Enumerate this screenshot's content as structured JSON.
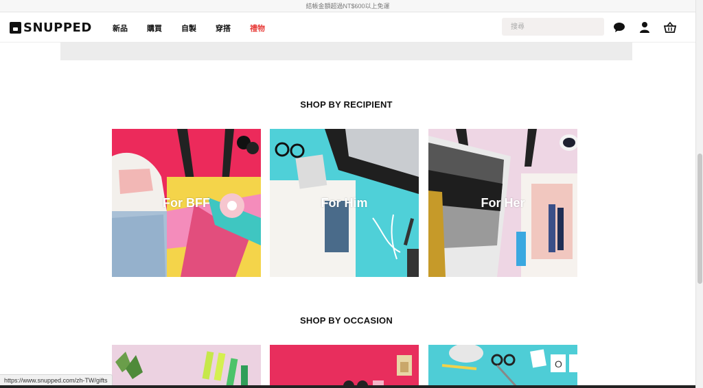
{
  "topbar": {
    "promo": "結帳金額超過NT$600以上免運"
  },
  "header": {
    "logo_text": "SNUPPED",
    "nav": [
      {
        "label": "新品",
        "active": false
      },
      {
        "label": "購買",
        "active": false
      },
      {
        "label": "自製",
        "active": false
      },
      {
        "label": "穿搭",
        "active": false
      },
      {
        "label": "禮物",
        "active": true
      }
    ],
    "search_placeholder": "搜尋",
    "icons": [
      "chat-icon",
      "user-icon",
      "basket-icon"
    ],
    "active_color": "#e8403d"
  },
  "recipient": {
    "title": "SHOP BY RECIPIENT",
    "cards": [
      {
        "label": "For BFF",
        "bg": "#ec2a5b"
      },
      {
        "label": "For Him",
        "bg": "#4fd0d8"
      },
      {
        "label": "For Her",
        "bg": "#eed6e4"
      }
    ]
  },
  "occasion": {
    "title": "SHOP BY OCCASION",
    "cards": [
      {
        "bg": "#ecd2e1"
      },
      {
        "bg": "#e82e5d"
      },
      {
        "bg": "#4ecdd6"
      }
    ]
  },
  "status_bar": {
    "url": "https://www.snupped.com/zh-TW/gifts"
  }
}
